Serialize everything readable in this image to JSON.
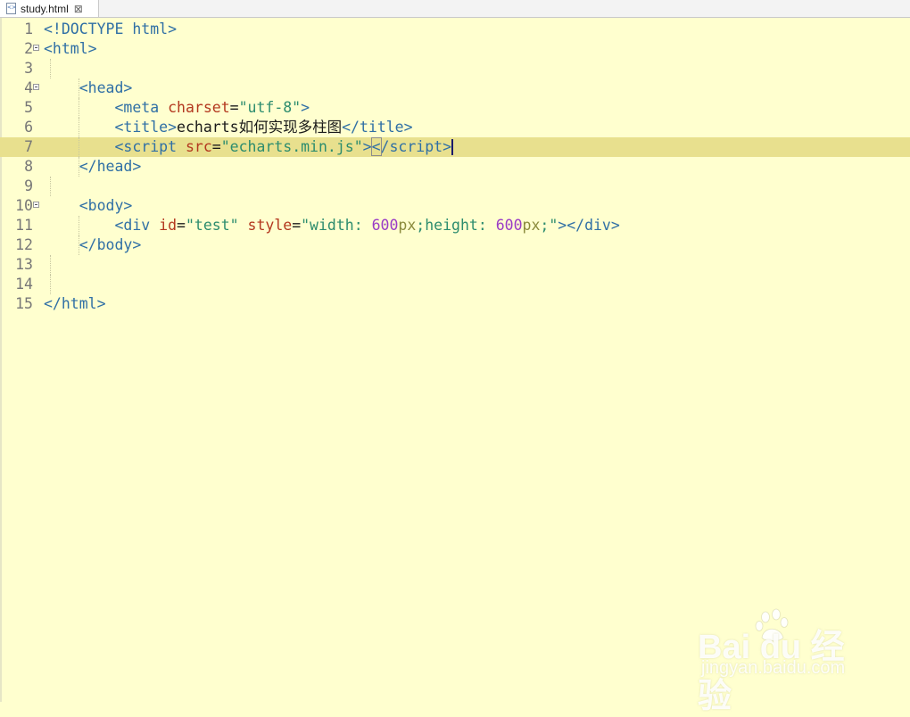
{
  "tab": {
    "filename": "study.html",
    "close_glyph": "⊠"
  },
  "lines": [
    {
      "num": "1",
      "fold": false,
      "parts": [
        [
          "t",
          "<!DOCTYPE html>"
        ]
      ]
    },
    {
      "num": "2",
      "fold": true,
      "parts": [
        [
          "t",
          "<html>"
        ]
      ]
    },
    {
      "num": "3",
      "fold": false,
      "parts": []
    },
    {
      "num": "4",
      "fold": true,
      "parts": [
        [
          "p",
          "    "
        ],
        [
          "t",
          "<head>"
        ]
      ]
    },
    {
      "num": "5",
      "fold": false,
      "parts": [
        [
          "p",
          "        "
        ],
        [
          "t",
          "<meta "
        ],
        [
          "a",
          "charset"
        ],
        [
          "p",
          "="
        ],
        [
          "s",
          "\"utf-8\""
        ],
        [
          "t",
          ">"
        ]
      ]
    },
    {
      "num": "6",
      "fold": false,
      "parts": [
        [
          "p",
          "        "
        ],
        [
          "t",
          "<title>"
        ],
        [
          "p",
          "echarts如何实现多柱图"
        ],
        [
          "t",
          "</title>"
        ]
      ]
    },
    {
      "num": "7",
      "fold": false,
      "current": true,
      "parts": [
        [
          "p",
          "        "
        ],
        [
          "t",
          "<script "
        ],
        [
          "a",
          "src"
        ],
        [
          "p",
          "="
        ],
        [
          "s",
          "\"echarts.min.js\""
        ],
        [
          "t",
          ">"
        ],
        [
          "tb",
          "<"
        ],
        [
          "t",
          "/script>"
        ],
        [
          "caret",
          ""
        ]
      ]
    },
    {
      "num": "8",
      "fold": false,
      "parts": [
        [
          "p",
          "    "
        ],
        [
          "t",
          "</head>"
        ]
      ]
    },
    {
      "num": "9",
      "fold": false,
      "parts": []
    },
    {
      "num": "10",
      "fold": true,
      "parts": [
        [
          "p",
          "    "
        ],
        [
          "t",
          "<body>"
        ]
      ]
    },
    {
      "num": "11",
      "fold": false,
      "parts": [
        [
          "p",
          "        "
        ],
        [
          "t",
          "<div "
        ],
        [
          "a",
          "id"
        ],
        [
          "p",
          "="
        ],
        [
          "s",
          "\"test\" "
        ],
        [
          "a",
          "style"
        ],
        [
          "p",
          "="
        ],
        [
          "s",
          "\"width: "
        ],
        [
          "n",
          "600"
        ],
        [
          "c",
          "px"
        ],
        [
          "s",
          ";height: "
        ],
        [
          "n",
          "600"
        ],
        [
          "c",
          "px"
        ],
        [
          "s",
          ";\""
        ],
        [
          "t",
          "></div>"
        ]
      ]
    },
    {
      "num": "12",
      "fold": false,
      "parts": [
        [
          "p",
          "    "
        ],
        [
          "t",
          "</body>"
        ]
      ]
    },
    {
      "num": "13",
      "fold": false,
      "parts": []
    },
    {
      "num": "14",
      "fold": false,
      "parts": []
    },
    {
      "num": "15",
      "fold": false,
      "parts": [
        [
          "t",
          "</html>"
        ]
      ]
    }
  ],
  "watermark": {
    "brand": "Bai  du 经验",
    "url": "jingyan.baidu.com"
  },
  "colors": {
    "background": "#ffffcf",
    "current_line": "#e8e08e",
    "tag": "#2f6fa5",
    "attribute": "#b3381f",
    "string": "#2c8c6e",
    "number": "#9a3cc6",
    "line_number": "#777777"
  }
}
